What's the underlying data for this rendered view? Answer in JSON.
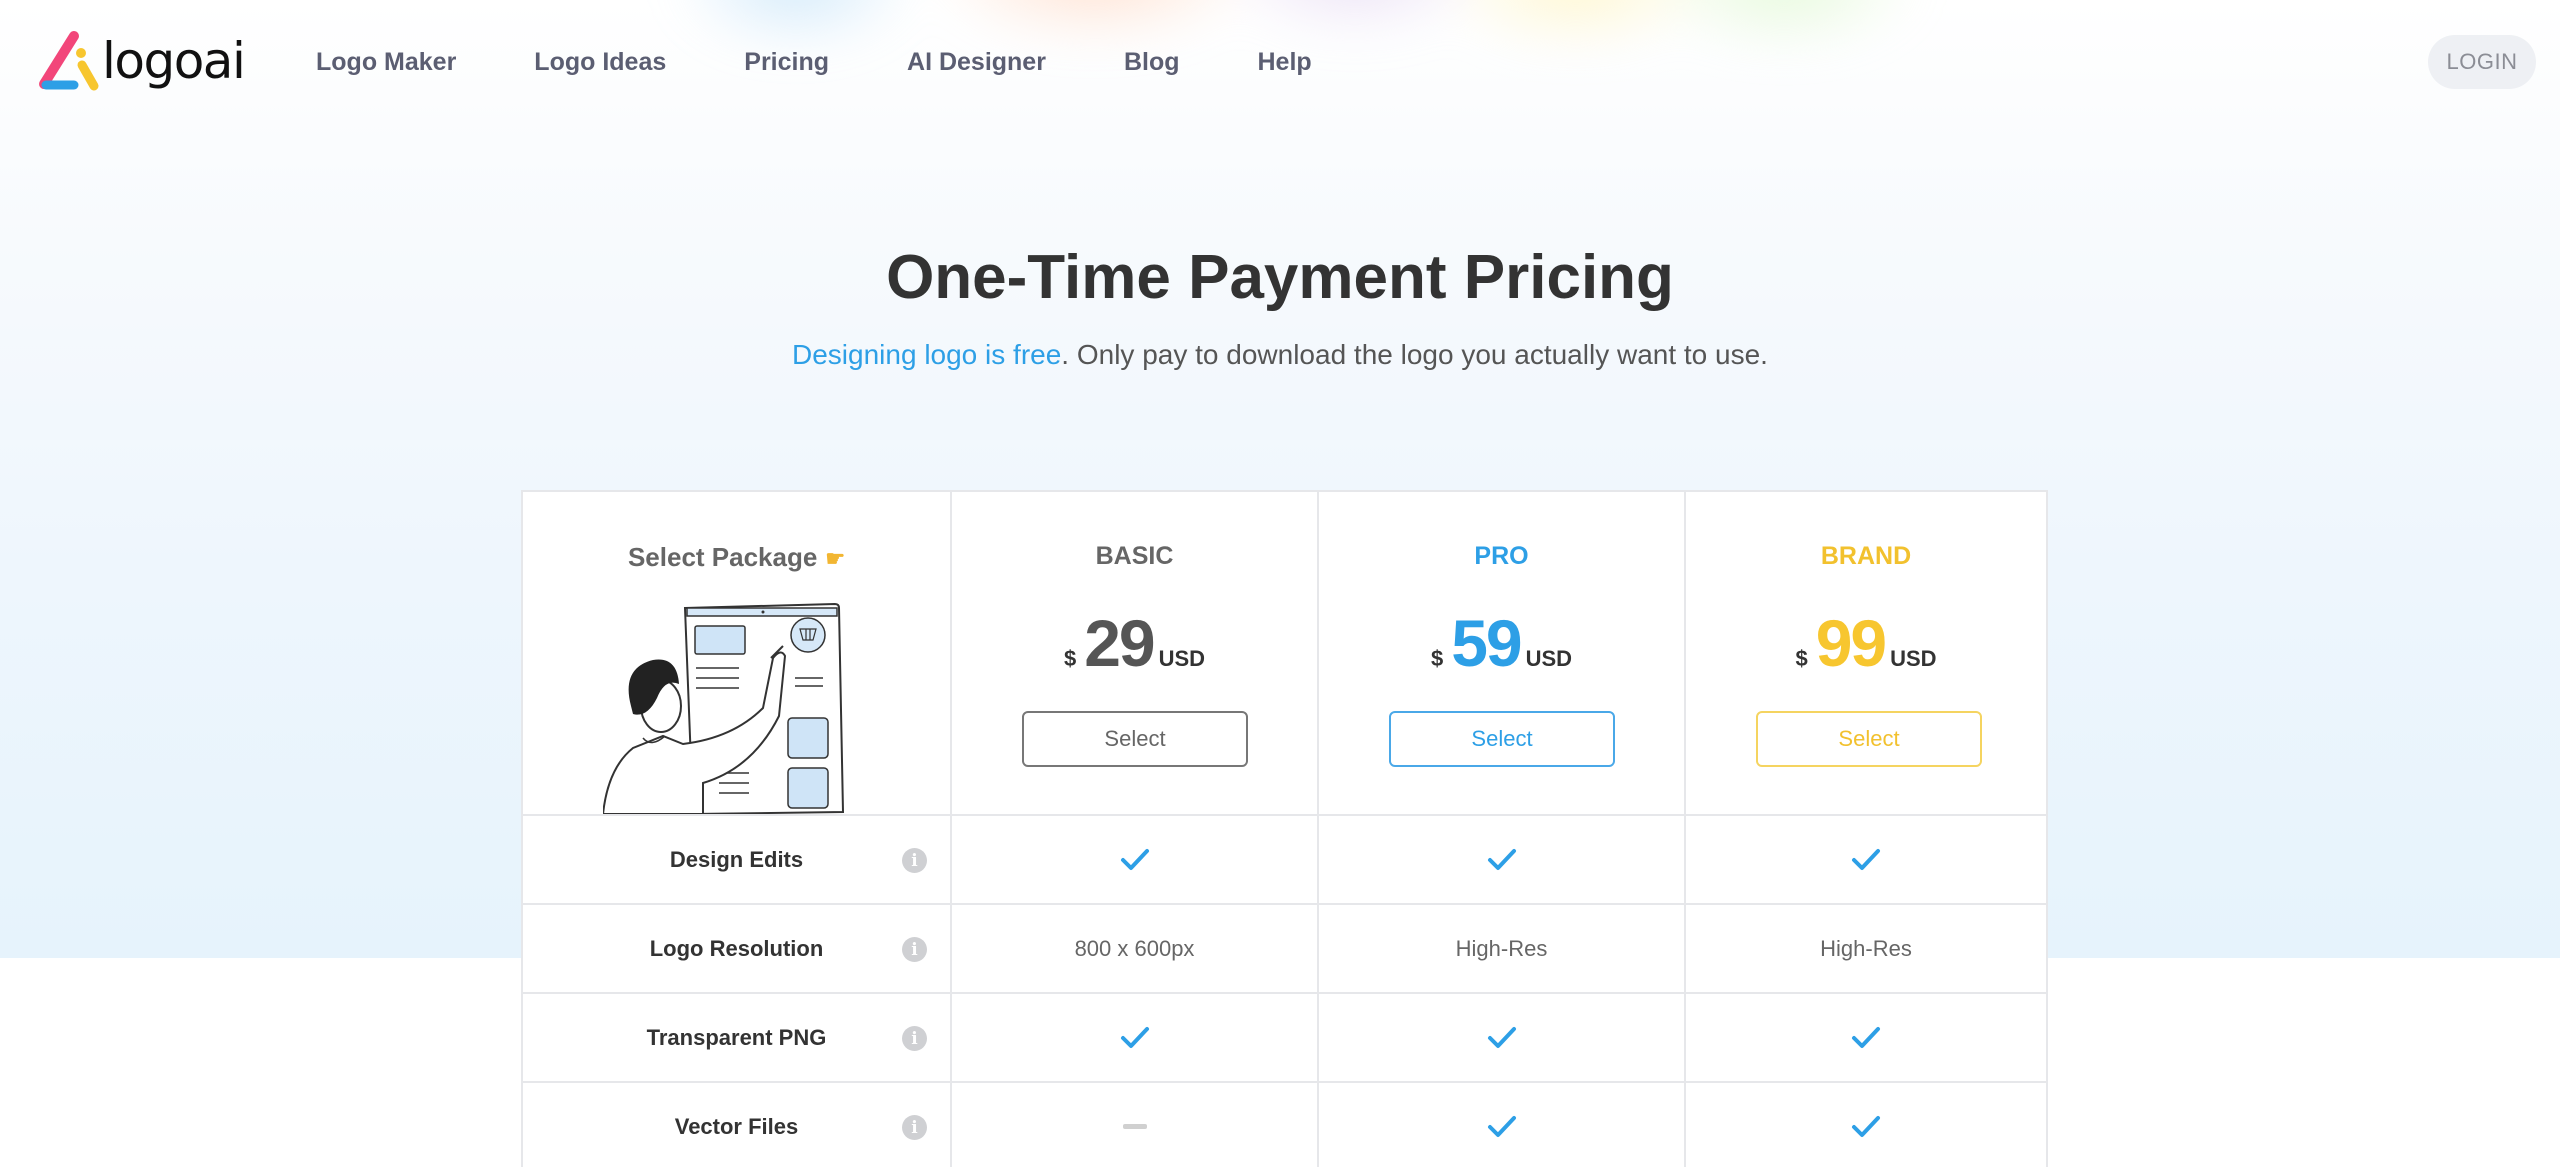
{
  "brand": {
    "name": "logoai",
    "colors": {
      "pink": "#f2467a",
      "blue": "#2d9fe6",
      "yellow": "#f7c62f"
    }
  },
  "nav": {
    "items": [
      {
        "label": "Logo Maker"
      },
      {
        "label": "Logo Ideas"
      },
      {
        "label": "Pricing"
      },
      {
        "label": "AI Designer"
      },
      {
        "label": "Blog"
      },
      {
        "label": "Help"
      }
    ],
    "login_label": "LOGIN"
  },
  "hero": {
    "title": "One-Time Payment Pricing",
    "subtitle_highlight": "Designing logo is free",
    "subtitle_rest": ". Only pay to download the logo you actually want to use."
  },
  "pricing": {
    "select_package_label": "Select Package",
    "pointer_icon": "backhand-index-pointing-right",
    "plans": [
      {
        "name": "BASIC",
        "currency": "$",
        "amount": "29",
        "unit": "USD",
        "button": "Select",
        "color": "#666666",
        "amount_color": "#555555",
        "border_color": "#777777"
      },
      {
        "name": "PRO",
        "currency": "$",
        "amount": "59",
        "unit": "USD",
        "button": "Select",
        "color": "#2d9fe6",
        "amount_color": "#2d9fe6",
        "border_color": "#4aa8e8"
      },
      {
        "name": "BRAND",
        "currency": "$",
        "amount": "99",
        "unit": "USD",
        "button": "Select",
        "color": "#f2c12e",
        "amount_color": "#f7c62f",
        "border_color": "#f5d460"
      }
    ],
    "features": [
      {
        "label": "Design Edits",
        "values": [
          "check",
          "check",
          "check"
        ]
      },
      {
        "label": "Logo Resolution",
        "values": [
          "800 x 600px",
          "High-Res",
          "High-Res"
        ]
      },
      {
        "label": "Transparent PNG",
        "values": [
          "check",
          "check",
          "check"
        ]
      },
      {
        "label": "Vector Files",
        "values": [
          "dash",
          "check",
          "check"
        ]
      }
    ],
    "check_color": "#2d9fe6"
  }
}
